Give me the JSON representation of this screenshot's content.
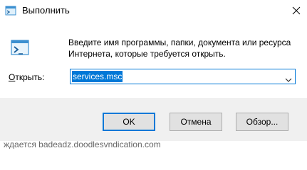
{
  "window": {
    "title": "Выполнить",
    "icon": "run-icon",
    "close_icon": "close-icon"
  },
  "description": {
    "line1": "Введите имя программы, папки, документа или ресурса",
    "line2": "Интернета, которые требуется открыть."
  },
  "open_field": {
    "label_prefix": "О",
    "label_rest": "ткрыть:",
    "value": "services.msc",
    "dropdown_icon": "chevron-down-icon"
  },
  "buttons": {
    "ok": "OK",
    "cancel": "Отмена",
    "browse": "Обзор..."
  },
  "background_text": "ждается badeadz.doodlesvndication.com",
  "colors": {
    "accent": "#0078d7",
    "footer_bg": "#f0f0f0",
    "button_bg": "#e1e1e1"
  }
}
